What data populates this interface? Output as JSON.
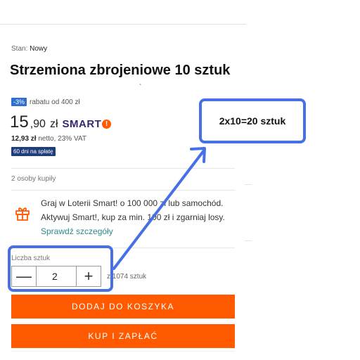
{
  "product": {
    "condition_label": "Stan:",
    "condition_value": "Nowy",
    "title": "Strzemiona zbrojeniowe 10 sztuk",
    "stray_mark": "`"
  },
  "pricing": {
    "discount_badge": "-3%",
    "discount_text": "rabatu od 400 zł",
    "price_int": "15",
    "price_dec": ",90",
    "currency": "zł",
    "smart_label": "SMART",
    "smart_badge": "!",
    "netto_price": "12,93 zł",
    "netto_text": "netto, 23% VAT",
    "days_badge": "60 dni na spłatę"
  },
  "social": {
    "bought_text": "2 osoby kupiły"
  },
  "promo": {
    "icon": "gift-icon",
    "text": "Graj w Loterii Smart! o 100 000 zł lub samochód. Aktywuj Smart!, kup za min. 100 zł i zgarniaj losy.",
    "link_text": "Sprawdź szczegóły"
  },
  "quantity": {
    "label": "Liczba sztuk",
    "value": "2",
    "minus_label": "—",
    "plus_label": "+",
    "availability": "z 1074 sztuk"
  },
  "buttons": {
    "add_to_cart": "DODAJ DO KOSZYKA",
    "buy_now": "KUP I ZAPŁAĆ"
  },
  "annotation": {
    "callout_text": "2x10=20 sztuk",
    "color": "#4870e6"
  },
  "colors": {
    "accent_orange": "#ff5a00",
    "smart_purple": "#3a2570",
    "link_teal": "#2c8a86"
  }
}
